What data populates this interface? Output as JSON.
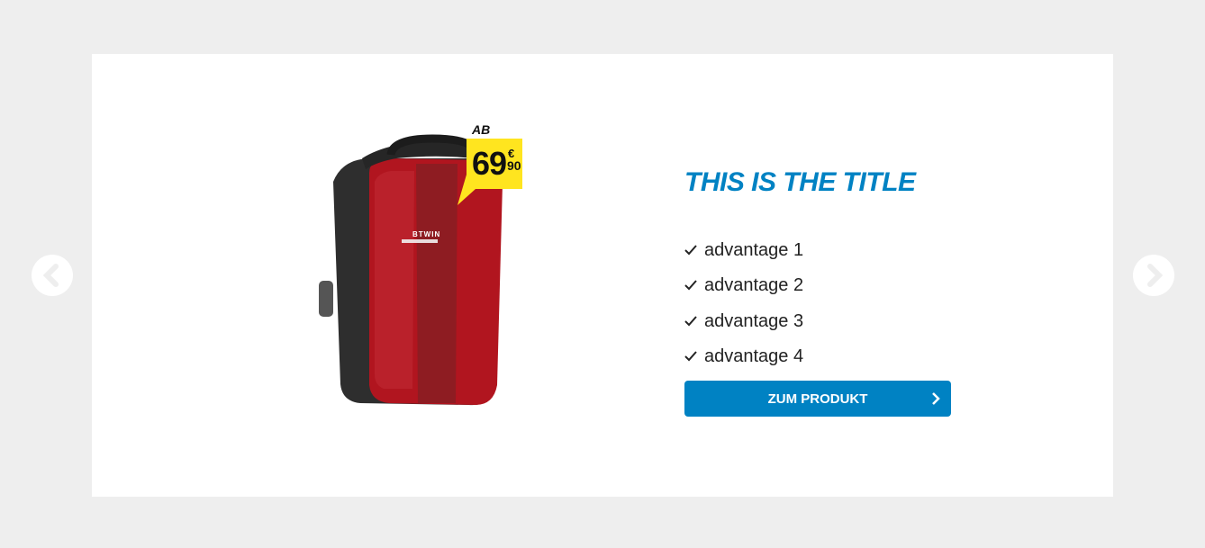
{
  "slide": {
    "title": "THIS IS THE TITLE",
    "advantages": [
      "advantage 1",
      "advantage 2",
      "advantage 3",
      "advantage 4"
    ],
    "cta_label": "ZUM PRODUKT"
  },
  "price": {
    "prefix": "AB",
    "main": "69",
    "currency": "€",
    "cents": "90"
  },
  "product": {
    "brand_text": "BTWIN"
  },
  "colors": {
    "page_background": "#eeeeee",
    "card_background": "#ffffff",
    "accent_blue": "#0082c3",
    "price_tag_yellow": "#ffe51f",
    "bag_red": "#b1151f",
    "bag_dark": "#2a2a2a"
  },
  "icons": {
    "prev": "chevron-left-icon",
    "next": "chevron-right-icon",
    "check": "check-icon",
    "cta_arrow": "chevron-right-icon"
  }
}
